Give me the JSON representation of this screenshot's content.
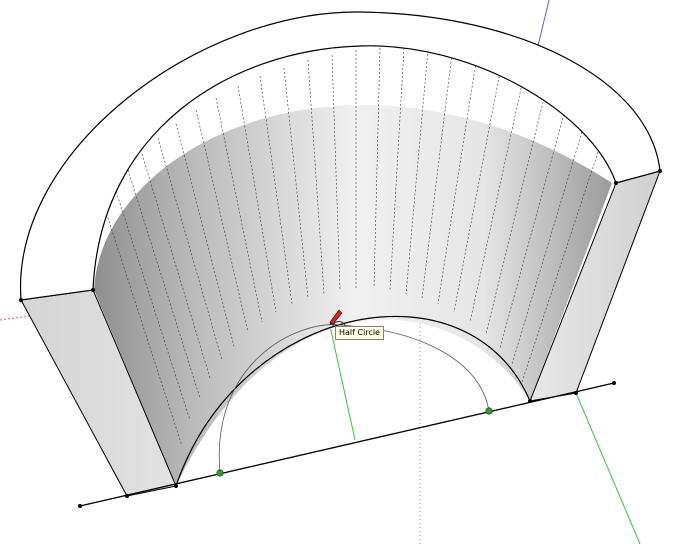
{
  "tool": {
    "name": "Half Circle",
    "icon": "pencil-arc-icon"
  },
  "colors": {
    "background": "#ffffff",
    "edge": "#000000",
    "top_face": "#ffffff",
    "side_face": "#dcdcdc",
    "axis_red": "#e06060",
    "axis_green": "#40c040",
    "axis_blue": "#6060d0",
    "snap_point": "#2e9e2e",
    "tooltip_bg": "#ffffe1"
  }
}
